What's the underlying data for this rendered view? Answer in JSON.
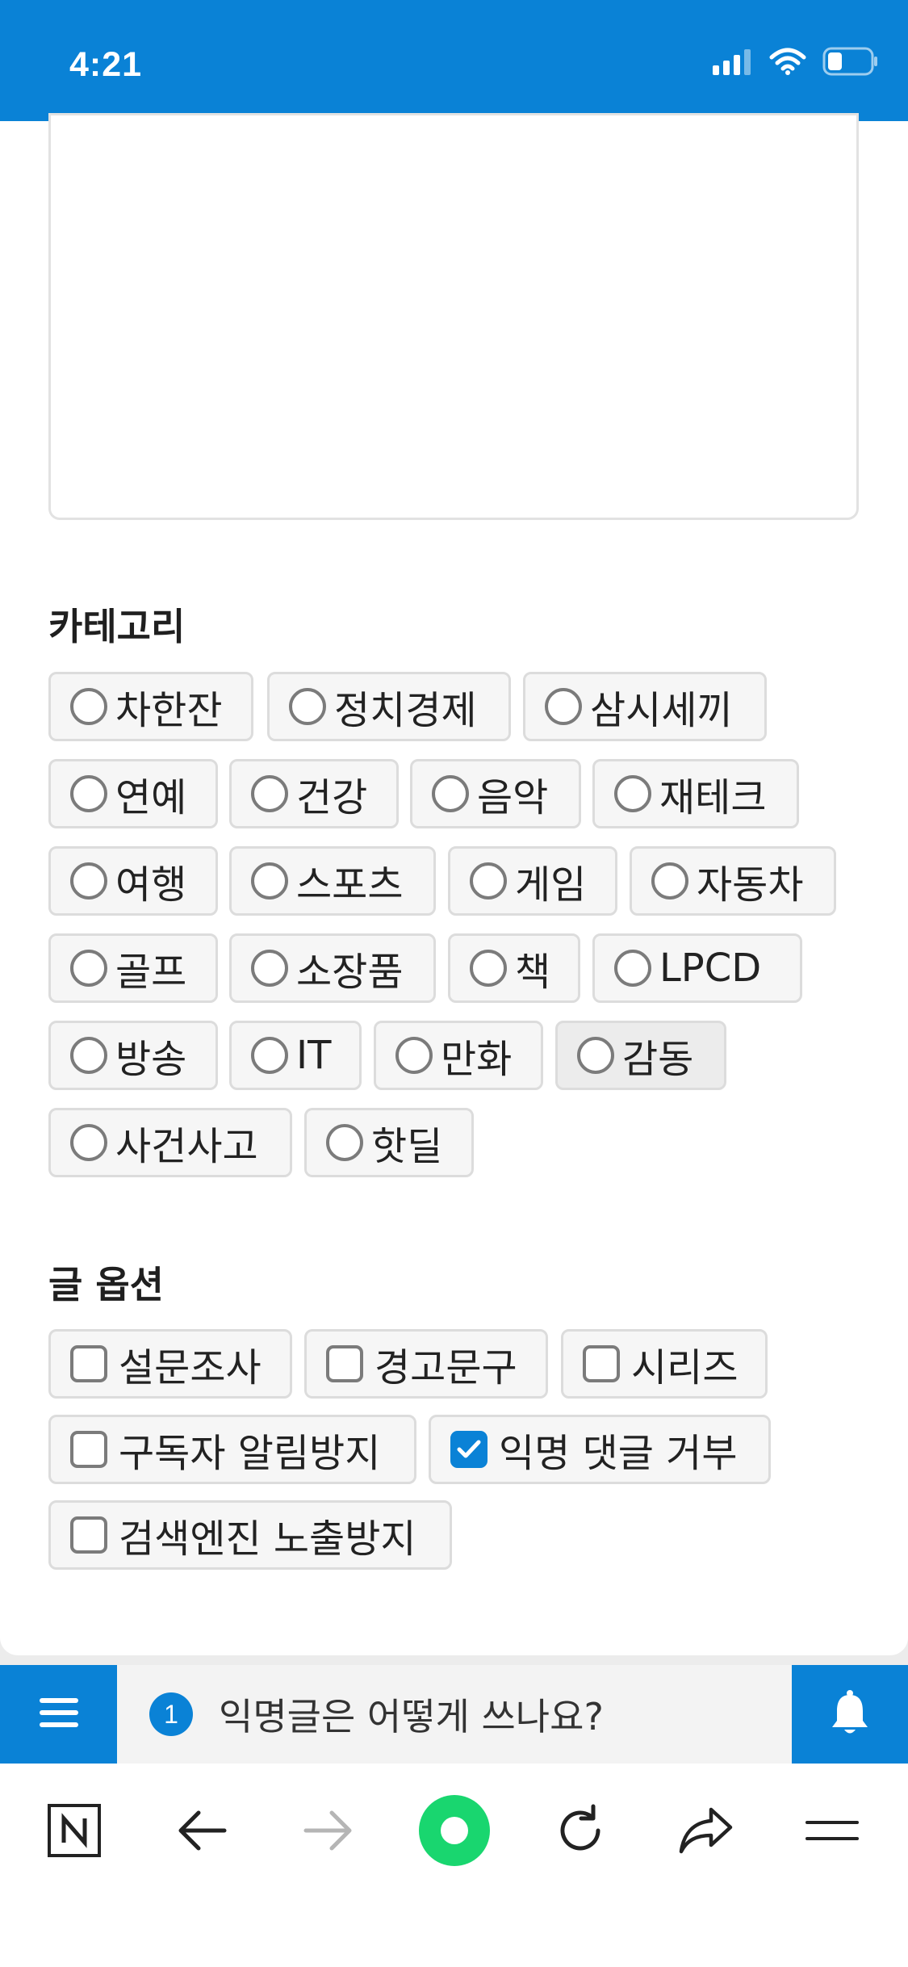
{
  "status": {
    "time": "4:21"
  },
  "category": {
    "title": "카테고리",
    "items": [
      "차한잔",
      "정치경제",
      "삼시세끼",
      "연예",
      "건강",
      "음악",
      "재테크",
      "여행",
      "스포츠",
      "게임",
      "자동차",
      "골프",
      "소장품",
      "책",
      "LPCD",
      "방송",
      "IT",
      "만화",
      "감동",
      "사건사고",
      "핫딜"
    ]
  },
  "options": {
    "title": "글 옵션",
    "items": [
      "설문조사",
      "경고문구",
      "시리즈",
      "구독자 알림방지",
      "익명 댓글 거부",
      "검색엔진 노출방지"
    ],
    "checked": [
      "익명 댓글 거부"
    ]
  },
  "notice": {
    "count": "1",
    "text": "익명글은 어떻게 쓰나요?"
  },
  "colors": {
    "accent": "#0a82d6",
    "home_green": "#19d66f"
  },
  "icons": [
    "signal-icon",
    "wifi-icon",
    "battery-icon",
    "menu-icon",
    "bell-icon",
    "naver-icon",
    "back-icon",
    "forward-icon",
    "home-icon",
    "reload-icon",
    "share-icon",
    "tabs-icon"
  ]
}
